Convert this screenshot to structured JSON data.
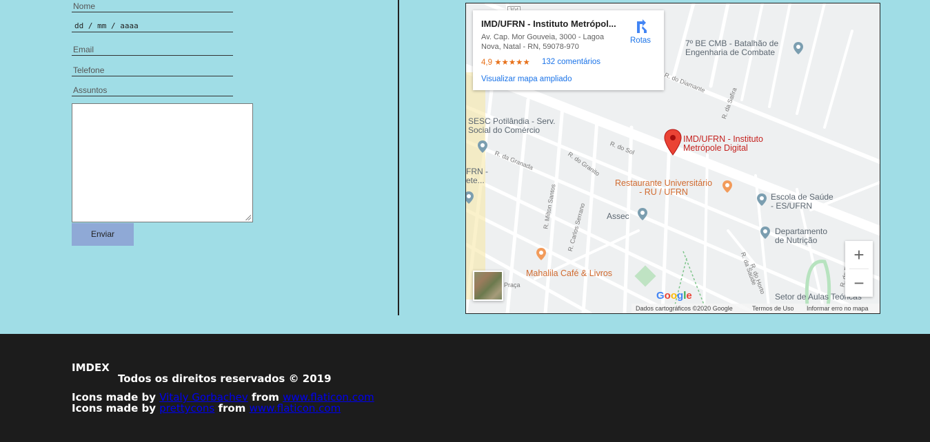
{
  "form": {
    "name_label": "Nome",
    "date_value": "dd / mm / aaaa",
    "email_label": "Email",
    "phone_label": "Telefone",
    "subjects_label": "Assuntos",
    "message_value": "",
    "send_label": "Enviar"
  },
  "map": {
    "card": {
      "title": "IMD/UFRN - Instituto Metrópol...",
      "address": "Av. Cap. Mor Gouveia, 3000 - Lagoa Nova, Natal - RN, 59078-970",
      "rating": "4,9",
      "stars": "★★★★★",
      "reviews": "132 comentários",
      "view_larger": "Visualizar mapa ampliado",
      "routes": "Rotas"
    },
    "places": {
      "imd": [
        "IMD/UFRN - Instituto",
        "Metrópole Digital"
      ],
      "bec": [
        "7º BE CMB - Batalhão de",
        "Engenharia de Combate"
      ],
      "sesc": [
        "SESC Potilândia - Serv.",
        "Social do Comércio"
      ],
      "ru": [
        "Restaurante Universitário",
        "- RU / UFRN"
      ],
      "escola": [
        "Escola de Saúde",
        "- ES/UFRN"
      ],
      "assec": "Assec",
      "nutricao": [
        "Departamento",
        "de Nutrição"
      ],
      "mahalila": "Mahalila Café & Livros",
      "setor": "Setor de Aulas Teóricas",
      "left_ufrn": [
        "FRN -",
        "ete..."
      ]
    },
    "streets": {
      "r_sol": "R. do Sol",
      "r_granada": "R. da Granada",
      "r_granito": "R. do Granito",
      "r_diamante": "R. do Diamante",
      "r_safira": "R. da Safira",
      "r_milton": "R. Milton Santos",
      "r_carlos": "R. Carlos Serrano",
      "r_saude": "R. da Saúde",
      "r_horto": "R. do Horto",
      "r_esporte": "R. do Esporte",
      "praca": "Praça",
      "road_num": "304"
    },
    "zoom_in": "+",
    "zoom_out": "−",
    "google": [
      "G",
      "o",
      "o",
      "g",
      "l",
      "e"
    ],
    "google_colors": [
      "#4285f4",
      "#ea4335",
      "#fbbc05",
      "#4285f4",
      "#34a853",
      "#ea4335"
    ],
    "attribution": {
      "data": "Dados cartográficos ©2020 Google",
      "terms": "Termos de Uso",
      "report": "Informar erro no mapa"
    }
  },
  "footer": {
    "brand": "IMDEX",
    "copyright": "Todos os direitos reservados © 2019",
    "credit1": {
      "prefix": "Icons made by",
      "author": "Vitaly Gorbachev",
      "mid": "from",
      "site": "www.flaticon.com"
    },
    "credit2": {
      "prefix": "Icons made by",
      "author": "prettycons",
      "mid": "from",
      "site": "www.flaticon.com"
    }
  },
  "colors": {
    "page_bg": "#a0dde6",
    "button_bg": "#8fa9d6",
    "footer_bg": "#1c1c1c",
    "link": "#0000ee",
    "map_red": "#c5221f",
    "map_orange": "#d16b30",
    "map_blue": "#1a73e8"
  }
}
